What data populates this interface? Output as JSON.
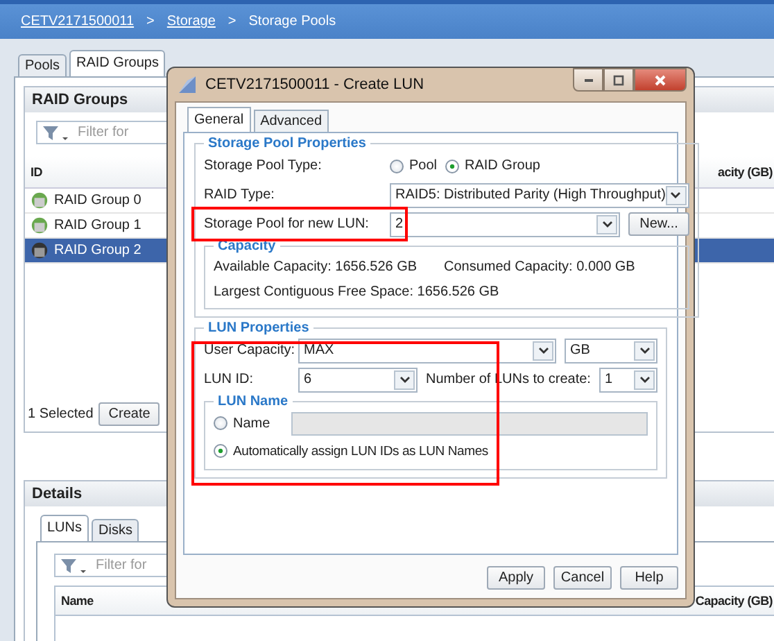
{
  "breadcrumb": [
    {
      "kind": "link",
      "text": "CETV2171500011"
    },
    {
      "kind": "separator",
      "text": ">"
    },
    {
      "kind": "link",
      "text": "Storage"
    },
    {
      "kind": "separator",
      "text": ">"
    },
    {
      "kind": "current",
      "text": "Storage Pools"
    }
  ],
  "page_tabs": [
    {
      "label": "Pools",
      "selected": false
    },
    {
      "label": "RAID Groups",
      "selected": true
    }
  ],
  "raid_groups_panel": {
    "title": "RAID Groups",
    "filter": {
      "placeholder": "Filter for"
    },
    "columns": [
      "ID",
      "acity (GB)"
    ],
    "rows": [
      {
        "id": "RAID Group 0",
        "selected": false
      },
      {
        "id": "RAID Group 1",
        "selected": false
      },
      {
        "id": "RAID Group 2",
        "selected": true
      }
    ],
    "selection_count": "1 Selected",
    "buttons": [
      "Create"
    ]
  },
  "details_panel": {
    "title": "Details",
    "tabs": [
      {
        "label": "LUNs",
        "selected": true
      },
      {
        "label": "Disks",
        "selected": false
      }
    ],
    "filter": {
      "placeholder": "Filter for"
    },
    "columns": [
      "Name",
      "Capacity (GB)"
    ]
  },
  "dialog": {
    "title": "CETV2171500011 - Create LUN",
    "tabs": [
      {
        "label": "General",
        "selected": true
      },
      {
        "label": "Advanced",
        "selected": false
      }
    ],
    "storage_pool_properties": {
      "legend": "Storage Pool Properties",
      "pool_type": {
        "label": "Storage Pool Type:",
        "options": [
          {
            "label": "Pool",
            "selected": false
          },
          {
            "label": "RAID Group",
            "selected": true
          }
        ]
      },
      "raid_type": {
        "label": "RAID Type:",
        "value": "RAID5: Distributed Parity (High Throughput)"
      },
      "pool_for_new_lun": {
        "label": "Storage Pool for new LUN:",
        "value": "2",
        "highlighted": true
      },
      "new_button": "New...",
      "capacity": {
        "legend": "Capacity",
        "available": "Available Capacity: 1656.526 GB",
        "consumed": "Consumed Capacity: 0.000 GB",
        "largest_free": "Largest Contiguous Free Space: 1656.526 GB"
      }
    },
    "lun_properties": {
      "legend": "LUN Properties",
      "highlighted": true,
      "user_capacity": {
        "label": "User Capacity:",
        "value": "MAX",
        "unit": "GB"
      },
      "lun_id": {
        "label": "LUN ID:",
        "value": "6"
      },
      "lun_count": {
        "label": "Number of LUNs to create:",
        "value": "1"
      },
      "lun_name": {
        "legend": "LUN Name",
        "options": [
          {
            "kind": "name",
            "label": "Name",
            "selected": false
          },
          {
            "kind": "auto",
            "label": "Automatically assign LUN IDs as LUN Names",
            "selected": true
          }
        ]
      }
    },
    "buttons": [
      "Apply",
      "Cancel",
      "Help"
    ]
  }
}
